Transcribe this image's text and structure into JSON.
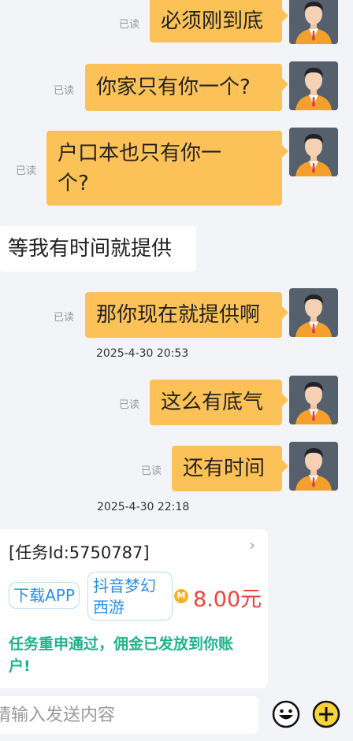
{
  "messages": [
    {
      "text": "必须刚到底",
      "status": "已读"
    },
    {
      "text": "你家只有你一个?",
      "status": "已读"
    },
    {
      "text_line1": "户口本也只有你一",
      "text_line2": "个?",
      "status": "已读"
    },
    {
      "text": "等我有时间就提供"
    },
    {
      "text": "那你现在就提供啊",
      "status": "已读"
    },
    {
      "time": "2025-4-30 20:53"
    },
    {
      "text": "这么有底气",
      "status": "已读"
    },
    {
      "text": "还有时间",
      "status": "已读"
    },
    {
      "time": "2025-4-30 22:18"
    }
  ],
  "task_card": {
    "task_id": "[任务Id:5750787]",
    "tag_app": "下载APP",
    "tag_game_line1": "抖音梦幻",
    "tag_game_line2": "西游",
    "coin_symbol": "M",
    "amount": "8.00元",
    "status_line1": "任务重申通过，佣金已发放到你账",
    "status_line2": "户!"
  },
  "input": {
    "placeholder": "请输入发送内容"
  },
  "icons": {
    "emoji": "emoji-icon",
    "add": "plus-icon",
    "chevron": "chevron-right-icon"
  },
  "colors": {
    "my_bubble": "#fdc257",
    "task_status": "#1fb38a",
    "amount": "#f0413a",
    "tag": "#2a8ee8"
  }
}
